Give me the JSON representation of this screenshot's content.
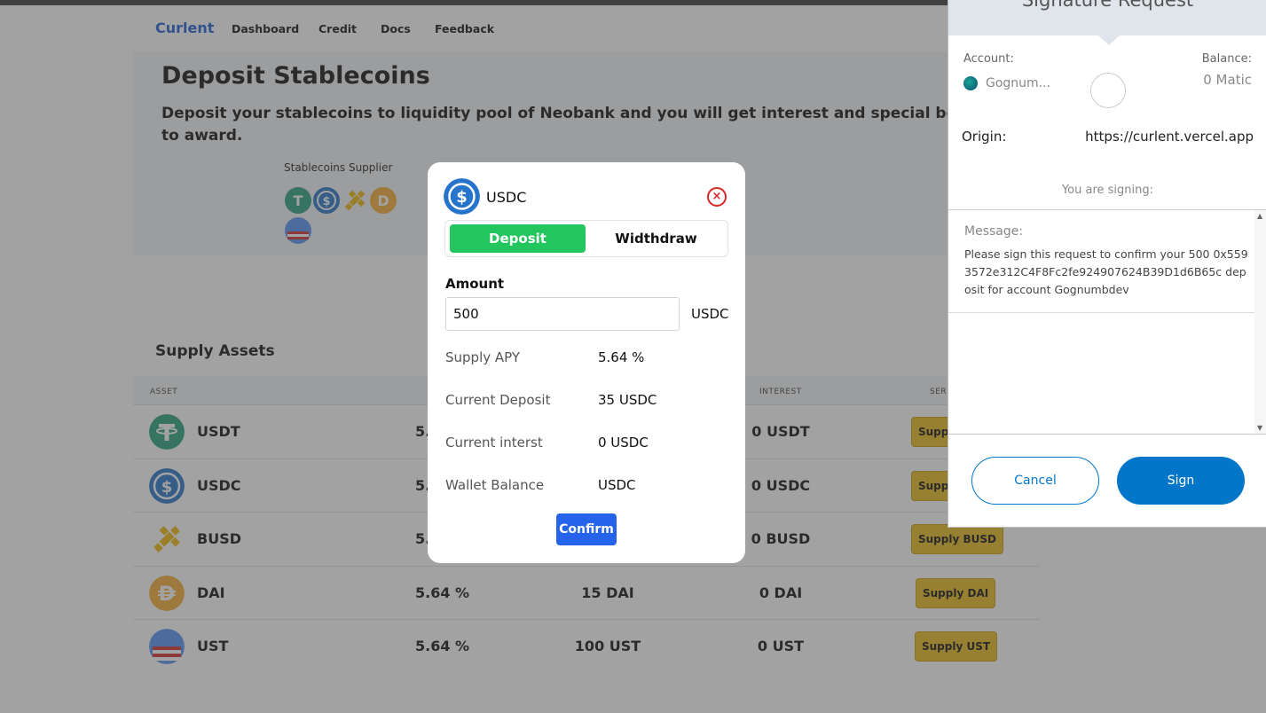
{
  "nav": {
    "brand": "Curlent",
    "links": [
      "Dashboard",
      "Credit",
      "Docs",
      "Feedback"
    ]
  },
  "hero": {
    "title": "Deposit Stablecoins",
    "subtitle": "Deposit your stablecoins to liquidity pool of Neobank and you will get interest and special benefit to award.",
    "supplier_label": "Stablecoins Supplier"
  },
  "supply": {
    "title": "Supply Assets",
    "headers": [
      "ASSET",
      "INTEREST",
      "SER"
    ],
    "rows": [
      {
        "name": "USDT",
        "apy": "5.",
        "deposit": "",
        "interest": "0 USDT",
        "button": "Supply",
        "icon": "usdt-icon",
        "color": "#26a17b"
      },
      {
        "name": "USDC",
        "apy": "5.",
        "deposit": "",
        "interest": "0 USDC",
        "button": "Suppl",
        "icon": "usdc-icon",
        "color": "#2775ca"
      },
      {
        "name": "BUSD",
        "apy": "5.",
        "deposit": "",
        "interest": "0 BUSD",
        "button": "Supply BUSD",
        "icon": "busd-icon",
        "color": "#f0b90b"
      },
      {
        "name": "DAI",
        "apy": "5.64 %",
        "deposit": "15 DAI",
        "interest": "0 DAI",
        "button": "Supply DAI",
        "icon": "dai-icon",
        "color": "#f5ac37"
      },
      {
        "name": "UST",
        "apy": "5.64 %",
        "deposit": "100 UST",
        "interest": "0 UST",
        "button": "Supply UST",
        "icon": "ust-icon",
        "color": "#5493f7"
      }
    ]
  },
  "modal": {
    "asset": "USDC",
    "close": "×",
    "tab_deposit": "Deposit",
    "tab_withdraw": "Widthdraw",
    "amount_label": "Amount",
    "amount_value": "500",
    "amount_unit": "USDC",
    "details": [
      {
        "label": "Supply APY",
        "value": "5.64 %"
      },
      {
        "label": "Current Deposit",
        "value": "35 USDC"
      },
      {
        "label": "Current interst",
        "value": "0 USDC"
      },
      {
        "label": "Wallet Balance",
        "value": "USDC"
      }
    ],
    "confirm": "Confirm"
  },
  "metamask": {
    "title": "Signature Request",
    "account_label": "Account:",
    "account_name": "Gognum...",
    "balance_label": "Balance:",
    "balance": "0 Matic",
    "origin_label": "Origin:",
    "origin": "https://curlent.vercel.app",
    "signing_label": "You are signing:",
    "message_label": "Message:",
    "message": "Please sign this request to confirm your 500 0x5593572e312C4F8Fc2fe924907624B39D1d6B65c deposit for account  Gognumbdev",
    "cancel": "Cancel",
    "sign": "Sign"
  },
  "colors": {
    "brand": "#1f5fd6",
    "deposit_tab": "#22c55e",
    "confirm": "#2563eb",
    "supply_button": "#e9bb1d",
    "metamask_blue": "#0376c9"
  }
}
